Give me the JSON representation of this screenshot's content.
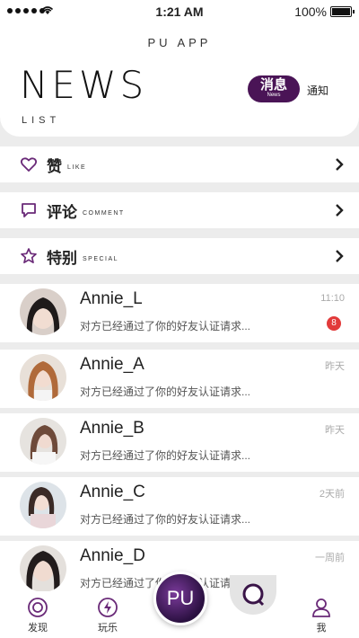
{
  "status_bar": {
    "time": "1:21 AM",
    "battery": "100%"
  },
  "header": {
    "app_title": "PU APP",
    "logo_main": "NEWS",
    "logo_sub": "LIST",
    "tab_active": "消息",
    "tab_active_sub": "News",
    "tab_other": "通知"
  },
  "menu": [
    {
      "zh": "赞",
      "en": "LIKE",
      "icon": "heart-icon"
    },
    {
      "zh": "评论",
      "en": "COMMENT",
      "icon": "comment-icon"
    },
    {
      "zh": "特别",
      "en": "SPECIAL",
      "icon": "star-icon"
    }
  ],
  "messages": [
    {
      "name": "Annie_L",
      "preview": "对方已经通过了你的好友认证请求...",
      "time": "11:10",
      "badge": "8"
    },
    {
      "name": "Annie_A",
      "preview": "对方已经通过了你的好友认证请求...",
      "time": "昨天"
    },
    {
      "name": "Annie_B",
      "preview": "对方已经通过了你的好友认证请求...",
      "time": "昨天"
    },
    {
      "name": "Annie_C",
      "preview": "对方已经通过了你的好友认证请求...",
      "time": "2天前"
    },
    {
      "name": "Annie_D",
      "preview": "对方已经通过了你的好友认证请求...",
      "time": "一周前"
    }
  ],
  "tabbar": {
    "discover": "发现",
    "play": "玩乐",
    "center": "PU",
    "me": "我"
  },
  "colors": {
    "accent": "#4a1456",
    "badge": "#e23a3a",
    "icon": "#6a2a78"
  }
}
